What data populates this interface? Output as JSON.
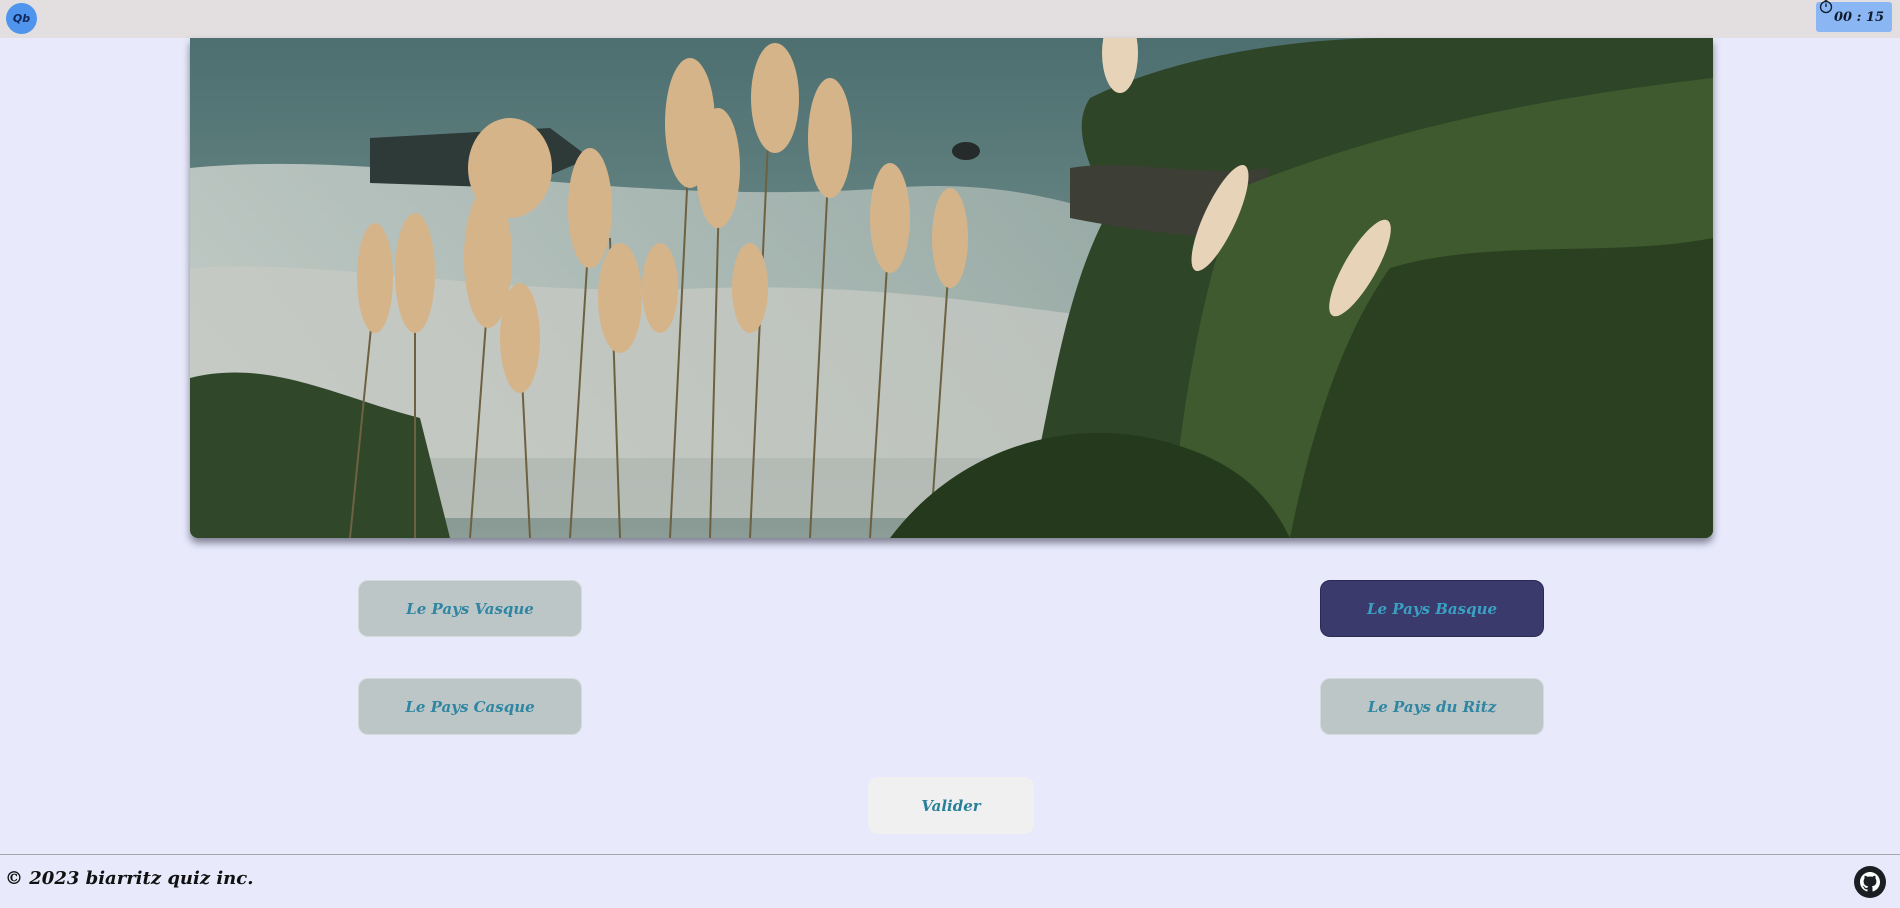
{
  "header": {
    "logo_text": "Qb",
    "timer": "00 : 15",
    "timer_icon": "stopwatch-icon"
  },
  "quiz": {
    "image_subject": "coastal-landscape-photo",
    "answers": [
      {
        "label": "Le Pays Vasque",
        "selected": false
      },
      {
        "label": "Le Pays Basque",
        "selected": true
      },
      {
        "label": "Le Pays Casque",
        "selected": false
      },
      {
        "label": "Le Pays du Ritz",
        "selected": false
      }
    ],
    "validate_label": "Valider"
  },
  "footer": {
    "copyright": "© 2023 biarritz quiz inc.",
    "github_icon": "github-icon"
  },
  "colors": {
    "background": "#e8eafc",
    "header_bg": "#e3dfe0",
    "answer_bg": "#bdc6c6",
    "answer_selected_bg": "#3a3b6c",
    "answer_text": "#2f86a3",
    "timer_bg": "#8ab6f4"
  }
}
